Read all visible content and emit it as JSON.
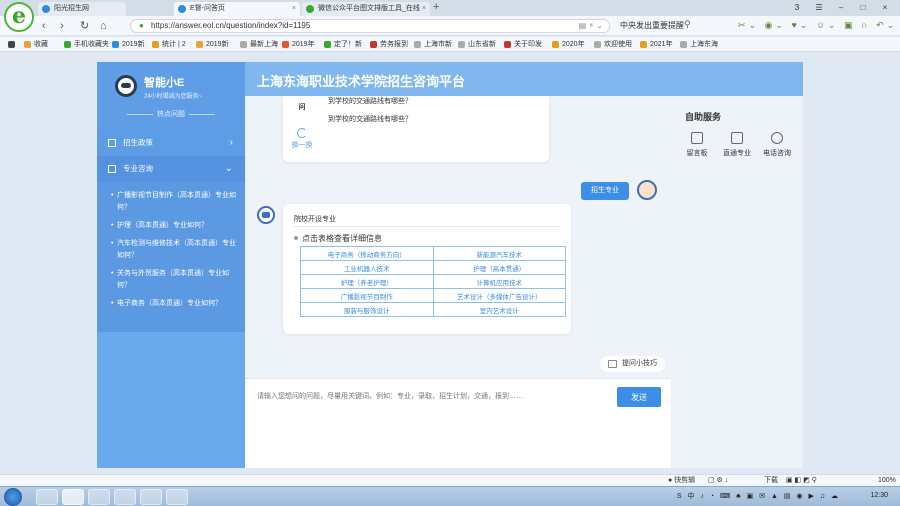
{
  "browser": {
    "tabs": [
      {
        "label": "阳光招生网",
        "active": false
      },
      {
        "label": "E督-问答页",
        "active": true
      },
      {
        "label": "微信公众平台图文排版工具_在线",
        "active": false
      }
    ],
    "url": "https://answer.eol.cn/question/index?id=1195",
    "search_text": "中央发出重要提醒",
    "bookmarks": [
      "收藏",
      "手机收藏夹",
      "2019新",
      "统计 | 2",
      "2019新",
      "最新上海",
      "2019年",
      "定了！新",
      "劳务报到",
      "上海市新",
      "山东省新",
      "关于印发",
      "2020年",
      "欢迎使用",
      "2021年",
      "上海东海"
    ]
  },
  "sidebar": {
    "bot_name": "智能小E",
    "bot_subtitle": "24小时竭诚为您服务~",
    "hot_title": "热点问题",
    "menu": [
      {
        "label": "招生政策",
        "arrow": "›"
      },
      {
        "label": "专业咨询",
        "arrow": "⌄"
      }
    ],
    "questions": [
      "广播影视节目制作（高本贯通）专业如何？",
      "护理（高本贯通）专业如何？",
      "汽车检测与维修技术（高本贯通）专业如何？",
      "关务与外贸服务（高本贯通）专业如何？",
      "电子商务（高本贯通）专业如何？"
    ]
  },
  "header": {
    "title": "上海东海职业技术学院招生咨询平台"
  },
  "chat": {
    "top_card": {
      "side_label": "问",
      "questions": [
        "到学校的交通路线有哪些？",
        "到学校的交通路线有哪些？"
      ],
      "refresh_label": "换一换"
    },
    "user_message": "招生专业",
    "answer": {
      "title": "院校开设专业",
      "table_caption": "点击表格查看详细信息",
      "majors": [
        [
          "电子商务（移动商务方向）",
          "新能源汽车技术"
        ],
        [
          "工业机器人技术",
          "护理（高本贯通）"
        ],
        [
          "护理（养老护理）",
          "计算机应用技术"
        ],
        [
          "广播影视节目制作",
          "艺术设计（多媒体广告设计）"
        ],
        [
          "服装与服饰设计",
          "室内艺术设计"
        ]
      ]
    },
    "tips_label": "提问小技巧"
  },
  "input": {
    "placeholder": "请输入您想问的问题，尽量用关键词。例如：专业，录取，招生计划，交通，报到……",
    "send_label": "发送"
  },
  "right_panel": {
    "title": "自助服务",
    "items": [
      {
        "label": "留言板",
        "icon": "message-icon"
      },
      {
        "label": "直通专业",
        "icon": "book-icon"
      },
      {
        "label": "电话咨询",
        "icon": "phone-icon"
      }
    ]
  },
  "statusbar": {
    "quick_edit": "快剪辑",
    "download": "下载",
    "zoom": "100%"
  },
  "taskbar": {
    "clock": "12:30"
  }
}
